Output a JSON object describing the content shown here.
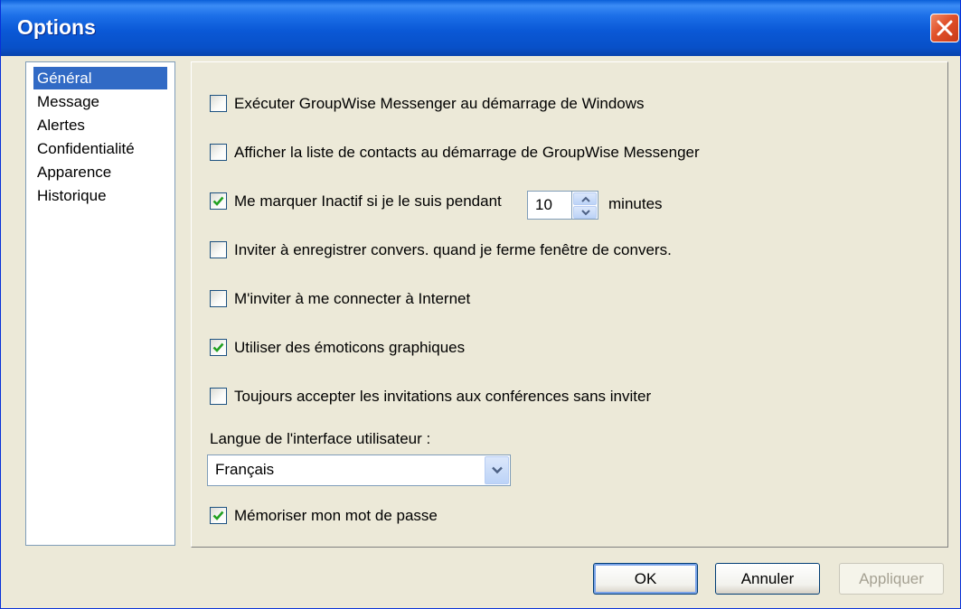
{
  "window": {
    "title": "Options"
  },
  "nav": {
    "items": [
      "Général",
      "Message",
      "Alertes",
      "Confidentialité",
      "Apparence",
      "Historique"
    ],
    "selected": "Général"
  },
  "options": [
    {
      "label": "Exécuter GroupWise Messenger au démarrage de Windows",
      "checked": false
    },
    {
      "label": "Afficher la liste de contacts au démarrage de GroupWise Messenger",
      "checked": false
    },
    {
      "label": "Me marquer Inactif si je le suis pendant",
      "checked": true
    },
    {
      "label": "Inviter à enregistrer convers. quand je ferme fenêtre de convers.",
      "checked": false
    },
    {
      "label": "M'inviter à me connecter à Internet",
      "checked": false
    },
    {
      "label": "Utiliser des émoticons graphiques",
      "checked": true
    },
    {
      "label": "Toujours accepter les invitations aux conférences sans inviter",
      "checked": false
    },
    {
      "label": "Mémoriser mon mot de passe",
      "checked": true
    }
  ],
  "idle": {
    "value": "10",
    "unit": "minutes"
  },
  "language": {
    "label": "Langue de l'interface utilisateur :",
    "value": "Français"
  },
  "buttons": {
    "ok": "OK",
    "cancel": "Annuler",
    "apply": "Appliquer"
  },
  "icons": {
    "close": "close-icon",
    "check": "check-icon",
    "spin_up": "chevron-up-icon",
    "spin_down": "chevron-down-icon",
    "dropdown": "chevron-down-icon"
  }
}
